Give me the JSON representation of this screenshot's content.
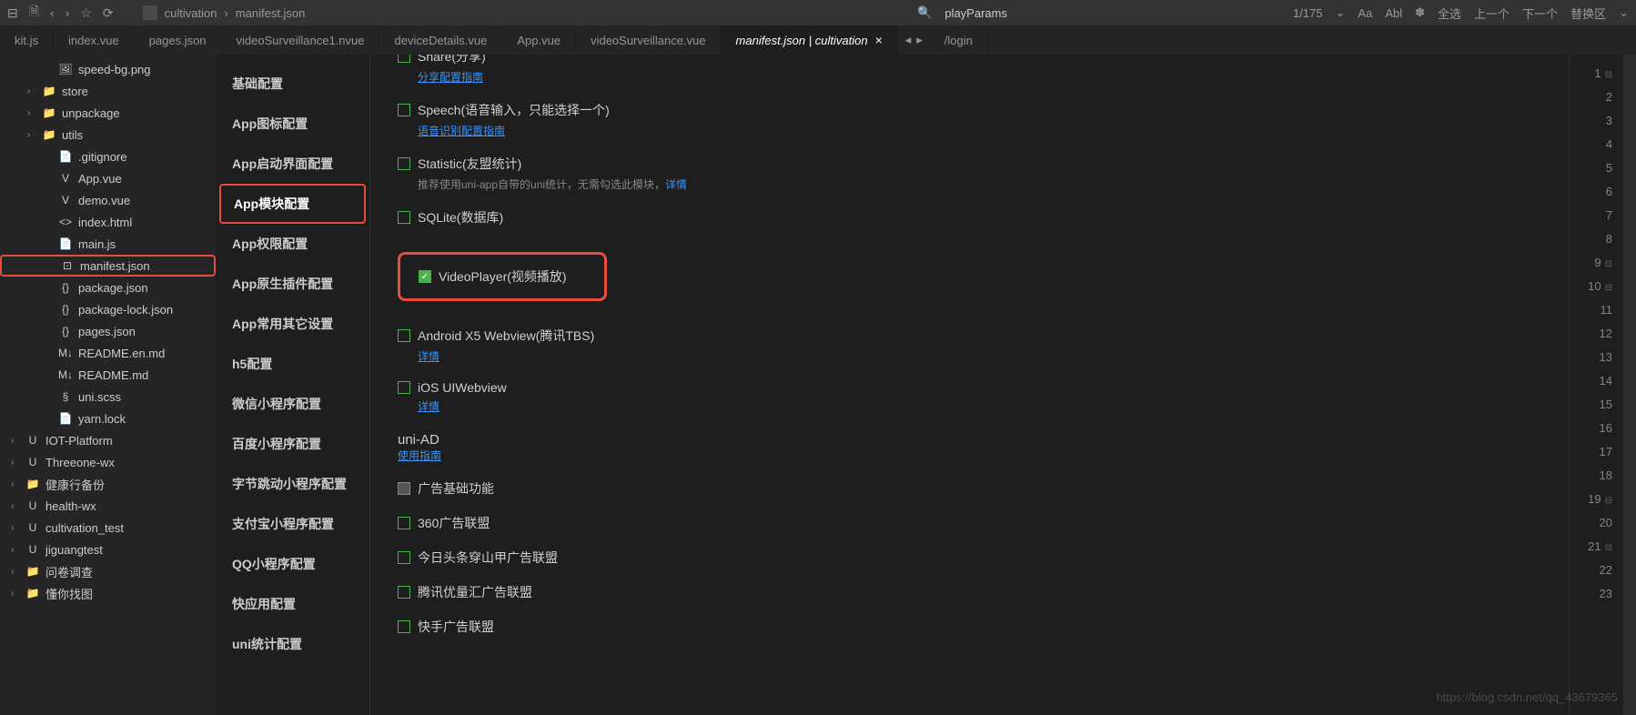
{
  "titlebar": {
    "breadcrumb": [
      "cultivation",
      "manifest.json"
    ],
    "search_text": "playParams",
    "search_count": "1/175",
    "actions": [
      "Aa",
      "Abl",
      "✽",
      "全选",
      "上一个",
      "下一个",
      "替换区"
    ]
  },
  "tabs": [
    {
      "label": "kit.js",
      "active": false
    },
    {
      "label": "index.vue",
      "active": false
    },
    {
      "label": "pages.json",
      "active": false
    },
    {
      "label": "videoSurveillance1.nvue",
      "active": false
    },
    {
      "label": "deviceDetails.vue",
      "active": false
    },
    {
      "label": "App.vue",
      "active": false
    },
    {
      "label": "videoSurveillance.vue",
      "active": false
    },
    {
      "label": "manifest.json | cultivation",
      "active": true
    },
    {
      "label": "/login",
      "active": false
    }
  ],
  "tree": [
    {
      "icon": "🖼",
      "label": "speed-bg.png",
      "indent": 2,
      "chev": ""
    },
    {
      "icon": "📁",
      "label": "store",
      "indent": 1,
      "chev": "›"
    },
    {
      "icon": "📁",
      "label": "unpackage",
      "indent": 1,
      "chev": "›"
    },
    {
      "icon": "📁",
      "label": "utils",
      "indent": 1,
      "chev": "›"
    },
    {
      "icon": "📄",
      "label": ".gitignore",
      "indent": 2,
      "chev": ""
    },
    {
      "icon": "V",
      "label": "App.vue",
      "indent": 2,
      "chev": ""
    },
    {
      "icon": "V",
      "label": "demo.vue",
      "indent": 2,
      "chev": ""
    },
    {
      "icon": "<>",
      "label": "index.html",
      "indent": 2,
      "chev": ""
    },
    {
      "icon": "📄",
      "label": "main.js",
      "indent": 2,
      "chev": ""
    },
    {
      "icon": "⊡",
      "label": "manifest.json",
      "indent": 2,
      "chev": "",
      "highlighted": true
    },
    {
      "icon": "{}",
      "label": "package.json",
      "indent": 2,
      "chev": ""
    },
    {
      "icon": "{}",
      "label": "package-lock.json",
      "indent": 2,
      "chev": ""
    },
    {
      "icon": "{}",
      "label": "pages.json",
      "indent": 2,
      "chev": ""
    },
    {
      "icon": "M↓",
      "label": "README.en.md",
      "indent": 2,
      "chev": ""
    },
    {
      "icon": "M↓",
      "label": "README.md",
      "indent": 2,
      "chev": ""
    },
    {
      "icon": "§",
      "label": "uni.scss",
      "indent": 2,
      "chev": ""
    },
    {
      "icon": "📄",
      "label": "yarn.lock",
      "indent": 2,
      "chev": ""
    },
    {
      "icon": "U",
      "label": "IOT-Platform",
      "indent": 0,
      "chev": "›"
    },
    {
      "icon": "U",
      "label": "Threeone-wx",
      "indent": 0,
      "chev": "›"
    },
    {
      "icon": "📁",
      "label": "健康行备份",
      "indent": 0,
      "chev": "›"
    },
    {
      "icon": "U",
      "label": "health-wx",
      "indent": 0,
      "chev": "›"
    },
    {
      "icon": "U",
      "label": "cultivation_test",
      "indent": 0,
      "chev": "›"
    },
    {
      "icon": "U",
      "label": "jiguangtest",
      "indent": 0,
      "chev": "›"
    },
    {
      "icon": "📁",
      "label": "问卷调查",
      "indent": 0,
      "chev": "›"
    },
    {
      "icon": "📁",
      "label": "懂你找图",
      "indent": 0,
      "chev": "›"
    }
  ],
  "config_nav": [
    {
      "label": "基础配置"
    },
    {
      "label": "App图标配置"
    },
    {
      "label": "App启动界面配置"
    },
    {
      "label": "App模块配置",
      "highlighted": true
    },
    {
      "label": "App权限配置"
    },
    {
      "label": "App原生插件配置"
    },
    {
      "label": "App常用其它设置"
    },
    {
      "label": "h5配置"
    },
    {
      "label": "微信小程序配置"
    },
    {
      "label": "百度小程序配置"
    },
    {
      "label": "字节跳动小程序配置"
    },
    {
      "label": "支付宝小程序配置"
    },
    {
      "label": "QQ小程序配置"
    },
    {
      "label": "快应用配置"
    },
    {
      "label": "uni统计配置"
    }
  ],
  "modules": {
    "share": {
      "title": "Share(分享)",
      "link": "分享配置指南",
      "checked": false
    },
    "speech": {
      "title": "Speech(语音输入，只能选择一个)",
      "link": "语音识别配置指南",
      "checked": false
    },
    "statistic": {
      "title": "Statistic(友盟统计)",
      "desc": "推荐使用uni-app自带的uni统计，无需勾选此模块，",
      "desc_link": "详情",
      "checked": false
    },
    "sqlite": {
      "title": "SQLite(数据库)",
      "checked": false
    },
    "videoplayer": {
      "title": "VideoPlayer(视频播放)",
      "checked": true
    },
    "x5": {
      "title": "Android X5 Webview(腾讯TBS)",
      "link": "详情",
      "checked": false
    },
    "ios_webview": {
      "title": "iOS UIWebview",
      "link": "详情",
      "checked": false
    }
  },
  "uniAD": {
    "title": "uni-AD",
    "link": "使用指南",
    "items": [
      {
        "label": "广告基础功能",
        "grey": true
      },
      {
        "label": "360广告联盟"
      },
      {
        "label": "今日头条穿山甲广告联盟"
      },
      {
        "label": "腾讯优量汇广告联盟"
      },
      {
        "label": "快手广告联盟"
      }
    ]
  },
  "line_numbers": [
    1,
    2,
    3,
    4,
    5,
    6,
    7,
    8,
    9,
    10,
    11,
    12,
    13,
    14,
    15,
    16,
    17,
    18,
    19,
    20,
    21,
    22,
    23
  ],
  "watermark": "https://blog.csdn.net/qq_43679365"
}
